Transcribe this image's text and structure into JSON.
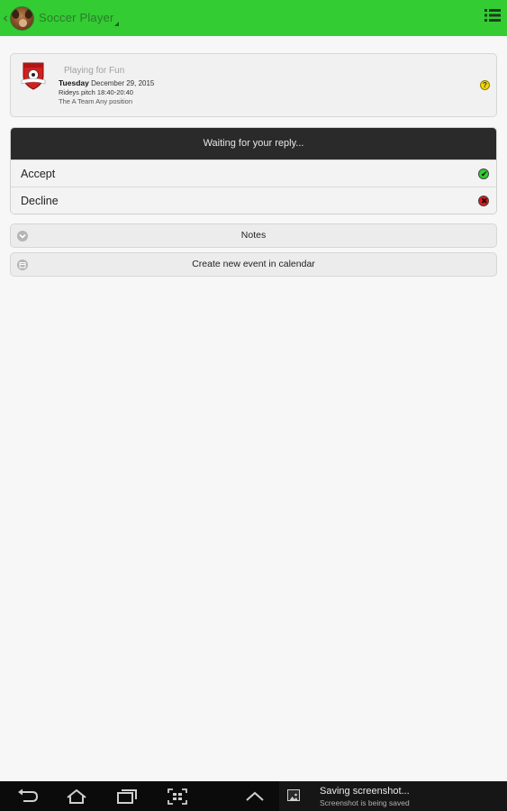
{
  "colors": {
    "action_bar": "#33cc33",
    "accept_status": "#2fcf2f",
    "decline_status": "#e01919",
    "help_badge": "#f2d600"
  },
  "action_bar": {
    "back_icon": "chevron-left-icon",
    "avatar_icon": "dog-avatar",
    "title": "Soccer Player",
    "menu_icon": "list-menu-icon"
  },
  "event": {
    "crest_icon": "team-crest-icon",
    "category": "Playing for Fun",
    "day": "Tuesday",
    "date": "December 29, 2015",
    "location_time": "Rideys pitch 18:40-20:40",
    "team_position": "The A Team Any position",
    "help_icon": "question-icon",
    "help_symbol": "?"
  },
  "reply": {
    "header": "Waiting for your reply...",
    "accept_label": "Accept",
    "accept_icon": "check-circle-icon",
    "accept_mark": "✔",
    "decline_label": "Decline",
    "decline_icon": "cross-circle-icon",
    "decline_mark": "✖"
  },
  "actions": {
    "notes_label": "Notes",
    "notes_icon": "chevron-down-circle-icon",
    "calendar_label": "Create new event in calendar",
    "calendar_icon": "calendar-circle-icon"
  },
  "system_bar": {
    "back_icon": "back-arrow-icon",
    "home_icon": "home-icon",
    "recents_icon": "recent-apps-icon",
    "screenshot_icon": "screenshot-icon",
    "up_icon": "chevron-up-icon",
    "notification_icon": "image-icon",
    "notification_title": "Saving screenshot...",
    "notification_subtitle": "Screenshot is being saved"
  }
}
